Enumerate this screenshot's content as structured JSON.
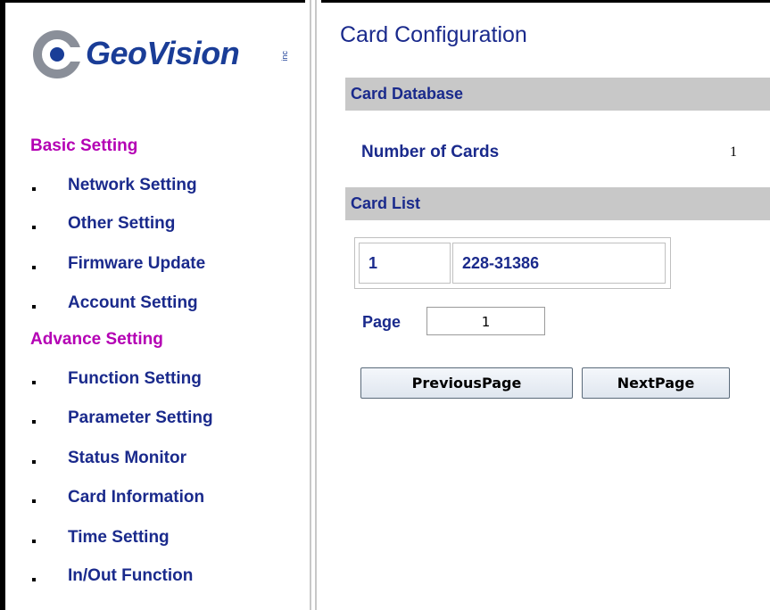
{
  "brand": {
    "name": "GeoVision",
    "inc": "inc"
  },
  "sidebar": {
    "basic_header": "Basic Setting",
    "basic_items": [
      {
        "label": "Network Setting"
      },
      {
        "label": "Other Setting"
      },
      {
        "label": "Firmware Update"
      },
      {
        "label": "Account Setting"
      }
    ],
    "advance_header": "Advance Setting",
    "advance_items": [
      {
        "label": "Function Setting"
      },
      {
        "label": "Parameter Setting"
      },
      {
        "label": "Status Monitor"
      },
      {
        "label": "Card Information"
      },
      {
        "label": "Time Setting"
      },
      {
        "label": "In/Out Function"
      }
    ]
  },
  "main": {
    "title": "Card Configuration",
    "database_section": "Card Database",
    "number_of_cards_label": "Number of Cards",
    "number_of_cards_value": "1",
    "list_section": "Card List",
    "cards": [
      {
        "index": "1",
        "number": "228-31386"
      }
    ],
    "page_label": "Page",
    "page_value": "1",
    "prev_button": "PreviousPage",
    "next_button": "NextPage"
  },
  "colors": {
    "nav_text": "#1a2a8c",
    "section_header": "#b400b4",
    "section_bar": "#c8c8c8"
  }
}
